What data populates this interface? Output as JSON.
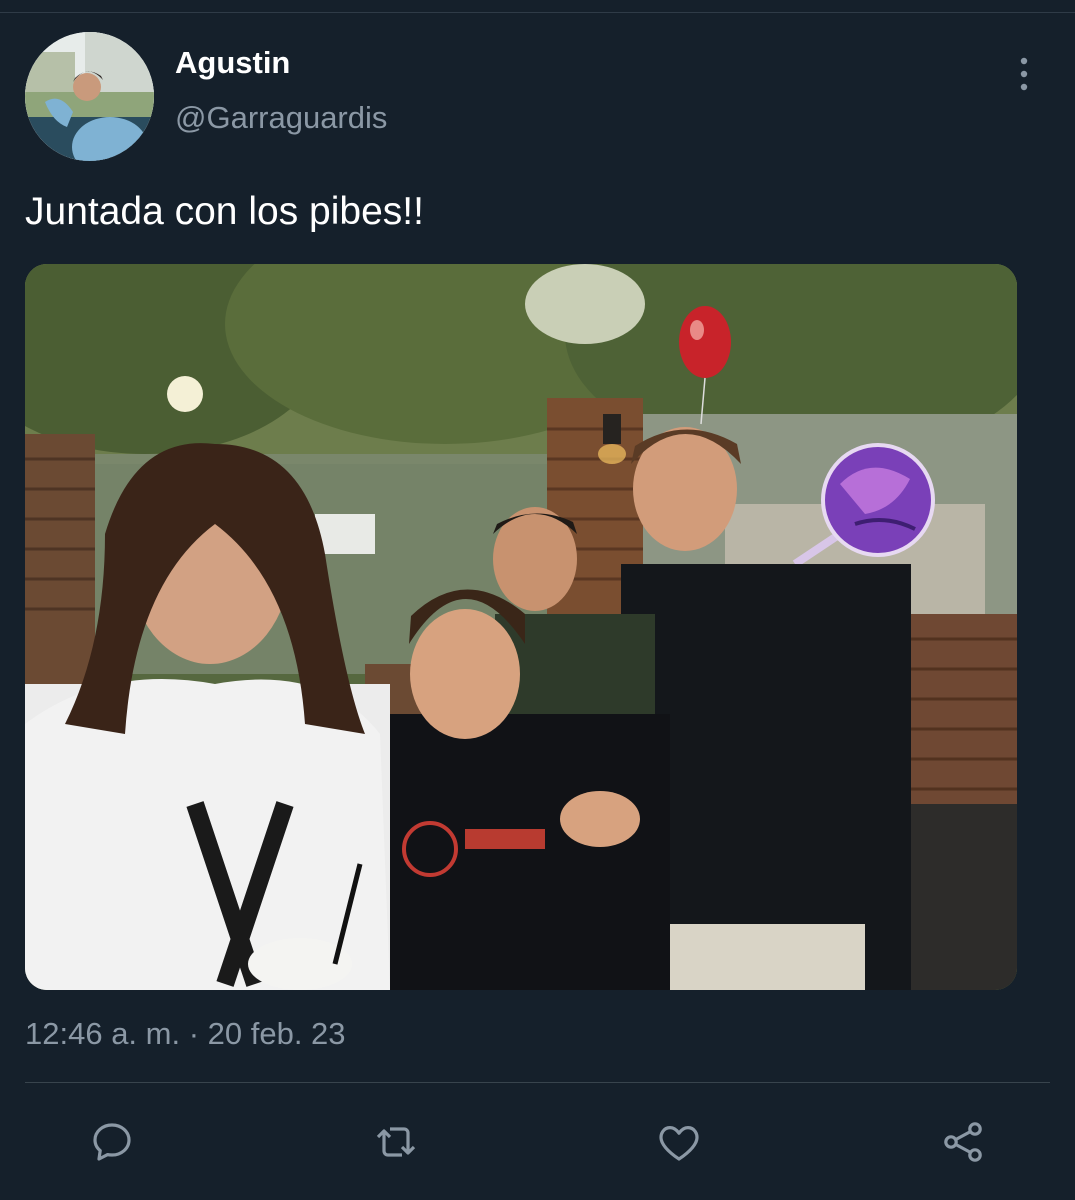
{
  "tweet": {
    "display_name": "Agustin",
    "handle": "@Garraguardis",
    "text": "Juntada con los pibes!!",
    "timestamp": "12:46 a. m. · 20 feb. 23"
  },
  "icons": {
    "more": "more-vertical-icon",
    "reply": "reply-icon",
    "retweet": "retweet-icon",
    "like": "heart-icon",
    "share": "share-icon"
  },
  "colors": {
    "background": "#15202b",
    "secondary_text": "#8b98a5",
    "divider": "#38444d",
    "icon": "#8b98a5"
  }
}
